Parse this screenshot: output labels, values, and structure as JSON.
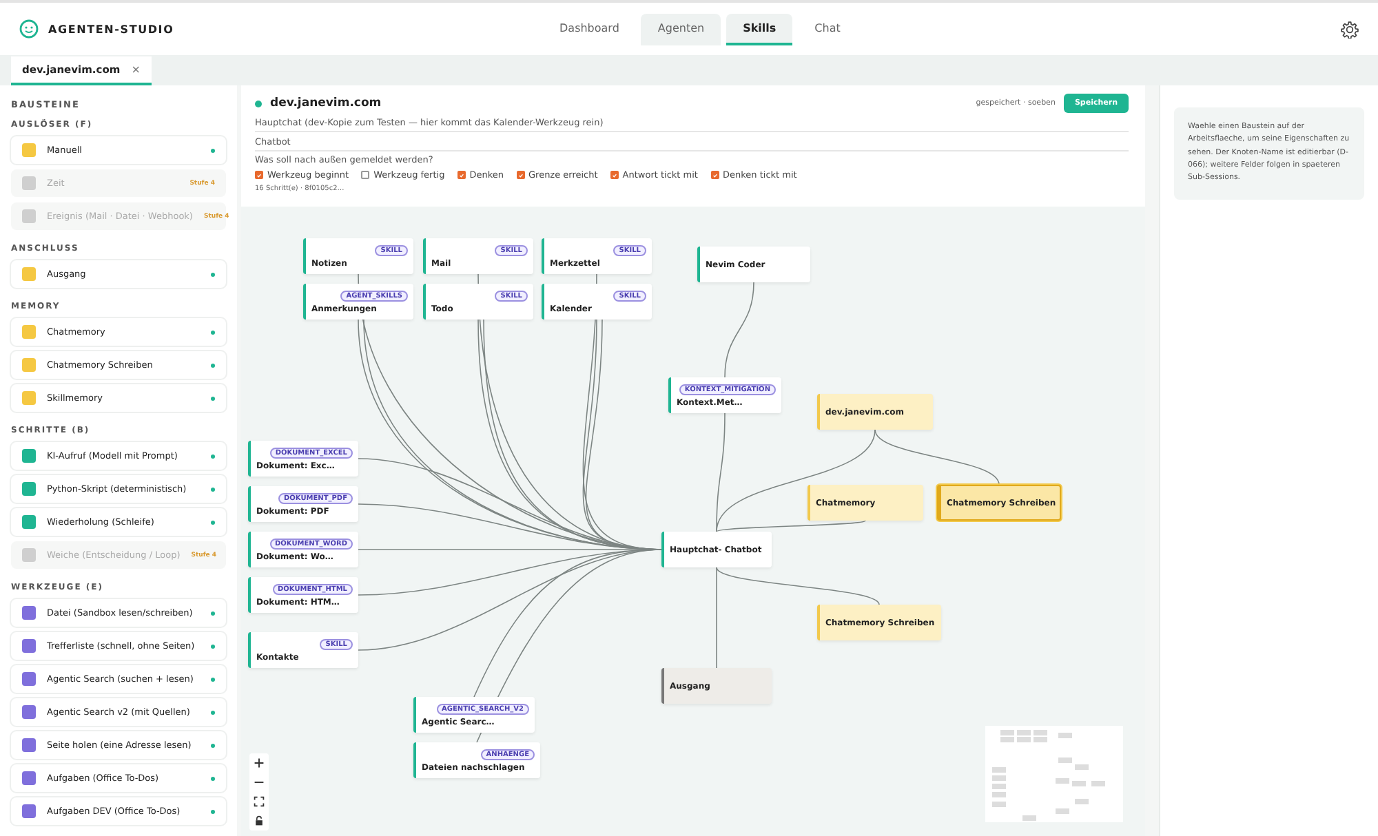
{
  "app": {
    "title": "AGENTEN-STUDIO"
  },
  "nav": [
    {
      "label": "Dashboard",
      "selected": false,
      "highlighted": false
    },
    {
      "label": "Agenten",
      "selected": false,
      "highlighted": true
    },
    {
      "label": "Skills",
      "selected": true,
      "highlighted": true
    },
    {
      "label": "Chat",
      "selected": false,
      "highlighted": false
    }
  ],
  "doc_tabs": [
    {
      "label": "dev.janevim.com",
      "close": "×",
      "selected": true
    }
  ],
  "palette": {
    "title": "BAUSTEINE",
    "sections": [
      {
        "title": "AUSLÖSER (F)",
        "items": [
          {
            "label": "Manuell",
            "color": "#f5c842",
            "disabled": false
          },
          {
            "label": "Zeit",
            "color": "#cfcfcf",
            "disabled": true,
            "badge": "Stufe 4"
          },
          {
            "label": "Ereignis (Mail · Datei · Webhook)",
            "color": "#cfcfcf",
            "disabled": true,
            "badge": "Stufe 4"
          }
        ]
      },
      {
        "title": "ANSCHLUSS",
        "items": [
          {
            "label": "Ausgang",
            "color": "#f5c842",
            "disabled": false
          }
        ]
      },
      {
        "title": "MEMORY",
        "items": [
          {
            "label": "Chatmemory",
            "color": "#f5c842",
            "disabled": false
          },
          {
            "label": "Chatmemory Schreiben",
            "color": "#f5c842",
            "disabled": false
          },
          {
            "label": "Skillmemory",
            "color": "#f5c842",
            "disabled": false
          }
        ]
      },
      {
        "title": "SCHRITTE (B)",
        "items": [
          {
            "label": "KI-Aufruf (Modell mit Prompt)",
            "color": "#1fb592",
            "disabled": false
          },
          {
            "label": "Python-Skript (deterministisch)",
            "color": "#1fb592",
            "disabled": false
          },
          {
            "label": "Wiederholung (Schleife)",
            "color": "#1fb592",
            "disabled": false
          },
          {
            "label": "Weiche (Entscheidung / Loop)",
            "color": "#cfcfcf",
            "disabled": true,
            "badge": "Stufe 4"
          }
        ]
      },
      {
        "title": "WERKZEUGE (E)",
        "items": [
          {
            "label": "Datei (Sandbox lesen/schreiben)",
            "color": "#7f6fdc",
            "disabled": false
          },
          {
            "label": "Trefferliste (schnell, ohne Seiten)",
            "color": "#7f6fdc",
            "disabled": false
          },
          {
            "label": "Agentic Search (suchen + lesen)",
            "color": "#7f6fdc",
            "disabled": false
          },
          {
            "label": "Agentic Search v2 (mit Quellen)",
            "color": "#7f6fdc",
            "disabled": false
          },
          {
            "label": "Seite holen (eine Adresse lesen)",
            "color": "#7f6fdc",
            "disabled": false
          },
          {
            "label": "Aufgaben (Office To-Dos)",
            "color": "#7f6fdc",
            "disabled": false
          },
          {
            "label": "Aufgaben DEV (Office To-Dos)",
            "color": "#7f6fdc",
            "disabled": false
          }
        ]
      }
    ]
  },
  "editor": {
    "name": "dev.janevim.com",
    "saved": "gespeichert · soeben",
    "save_button": "Speichern",
    "description": "Hauptchat (dev-Kopie zum Testen — hier kommt das Kalender-Werkzeug rein)",
    "role": "Chatbot",
    "question": "Was soll nach außen gemeldet werden?",
    "options": [
      {
        "label": "Werkzeug beginnt",
        "checked": true
      },
      {
        "label": "Werkzeug fertig",
        "checked": false
      },
      {
        "label": "Denken",
        "checked": true
      },
      {
        "label": "Grenze erreicht",
        "checked": true
      },
      {
        "label": "Antwort tickt mit",
        "checked": true
      },
      {
        "label": "Denken tickt mit",
        "checked": true
      }
    ],
    "steps": "16 Schritt(e) · 8f0105c2…"
  },
  "canvas": {
    "nodes": [
      {
        "kind": "tool",
        "title": "Notizen",
        "badge": "SKILL",
        "selected": false
      },
      {
        "kind": "tool",
        "title": "Mail",
        "badge": "SKILL",
        "selected": false
      },
      {
        "kind": "tool",
        "title": "Merkzettel",
        "badge": "SKILL",
        "selected": false
      },
      {
        "kind": "tool",
        "title": "Anmerkungen",
        "badge": "AGENT_SKILLS",
        "selected": false
      },
      {
        "kind": "tool",
        "title": "Todo",
        "badge": "SKILL",
        "selected": false
      },
      {
        "kind": "tool",
        "title": "Kalender",
        "badge": "SKILL",
        "selected": false
      },
      {
        "kind": "tool",
        "title": "Nevim Coder",
        "selected": false
      },
      {
        "kind": "tool",
        "title": "Kontext.Met…",
        "badge": "KONTEXT_MITIGATION",
        "selected": false
      },
      {
        "kind": "tool",
        "title": "Dokument: Exc…",
        "badge": "DOKUMENT_EXCEL",
        "selected": false
      },
      {
        "kind": "tool",
        "title": "Dokument: PDF",
        "badge": "DOKUMENT_PDF",
        "selected": false
      },
      {
        "kind": "tool",
        "title": "Dokument: Wo…",
        "badge": "DOKUMENT_WORD",
        "selected": false
      },
      {
        "kind": "tool",
        "title": "Dokument: HTM…",
        "badge": "DOKUMENT_HTML",
        "selected": false
      },
      {
        "kind": "tool",
        "title": "Kontakte",
        "badge": "SKILL",
        "selected": false
      },
      {
        "kind": "tool",
        "title": "Hauptchat- Chatbot",
        "selected": false
      },
      {
        "kind": "output",
        "title": "Ausgang",
        "selected": false
      },
      {
        "kind": "memory",
        "title": "dev.janevim.com",
        "selected": false
      },
      {
        "kind": "memory",
        "title": "Chatmemory",
        "selected": false
      },
      {
        "kind": "memory",
        "title": "Chatmemory Schreiben",
        "selected": true
      },
      {
        "kind": "memory",
        "title": "Chatmemory Schreiben",
        "selected": false
      },
      {
        "kind": "tool",
        "title": "Agentic Searc…",
        "badge": "AGENTIC_SEARCH_V2",
        "selected": false
      },
      {
        "kind": "tool",
        "title": "Dateien nachschlagen",
        "badge": "ANHAENGE",
        "selected": false
      }
    ]
  },
  "inspector": {
    "hint": "Waehle einen Baustein auf der Arbeitsflaeche, um seine Eigenschaften zu sehen. Der Knoten-Name ist editierbar (D-066); weitere Felder folgen in spaeteren Sub-Sessions."
  }
}
